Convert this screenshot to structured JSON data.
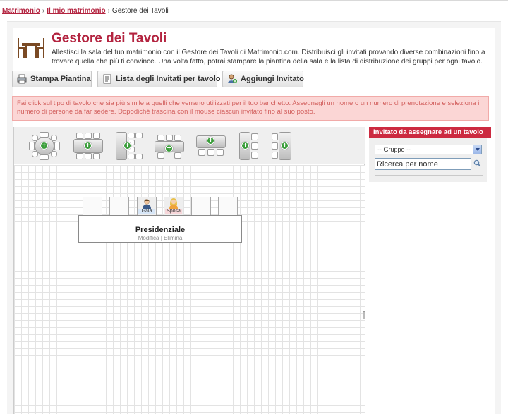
{
  "breadcrumb": {
    "link1": "Matrimonio",
    "link2": "Il mio matrimonio",
    "sep": "›",
    "current": "Gestore dei Tavoli"
  },
  "page": {
    "title": "Gestore dei Tavoli",
    "description": "Allestisci la sala del tuo matrimonio con il Gestore dei Tavoli di Matrimonio.com. Distribuisci gli invitati provando diverse combinazioni fino a trovare quella che più ti convince. Una volta fatto, potrai stampare la piantina della sala e la lista di distribuzione dei gruppi per ogni tavolo."
  },
  "toolbar": {
    "print_label": "Stampa Piantina",
    "guest_list_label": "Lista degli Invitati per tavolo",
    "add_guest_label": "Aggiungi Invitato"
  },
  "alert": {
    "text": "Fai click sul tipo di tavolo che sia più simile a quelli che verrano utilizzati per il tuo banchetto. Assegnagli un nome o un numero di prenotazione e seleziona il numero di persone da far sedere. Dopodiché trascina con il mouse ciascun invitato fino al suo posto."
  },
  "palette": {
    "icons": [
      "round-table-icon",
      "square-table-icon",
      "vertical-table-icon",
      "rectangular-table-icon",
      "long-table-icon",
      "single-side-table-icon",
      "double-side-table-icon"
    ]
  },
  "table": {
    "name": "Presidenziale",
    "edit_label": "Modifica",
    "delete_label": "Elimina",
    "link_sep": " | ",
    "guests": [
      "Gaia",
      "Sposa"
    ]
  },
  "sidebar": {
    "header": "Invitato da assegnare ad un tavolo",
    "group_select": "-- Gruppo --",
    "search_value": "Ricerca per nome"
  },
  "colors": {
    "brand": "#b3233f",
    "header_bg": "#cc2a40",
    "alert_bg": "#fbd6d5",
    "alert_text": "#d25f5d",
    "plus_green": "#3a9d3a"
  }
}
